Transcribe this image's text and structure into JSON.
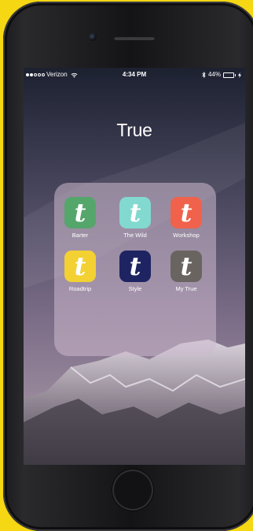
{
  "status_bar": {
    "carrier": "Verizon",
    "time": "4:34 PM",
    "battery_percent": "44%",
    "battery_level": 0.44,
    "signal_dots_filled": 2,
    "signal_dots_total": 5
  },
  "folder": {
    "title": "True",
    "apps": [
      {
        "label": "Barter",
        "letter": "t",
        "color": "#55a66b"
      },
      {
        "label": "The Wild",
        "letter": "t",
        "color": "#82d9cf"
      },
      {
        "label": "Workshop",
        "letter": "t",
        "color": "#f0624b"
      },
      {
        "label": "Roadtrip",
        "letter": "t",
        "color": "#f3d133"
      },
      {
        "label": "Style",
        "letter": "t",
        "color": "#1e2462"
      },
      {
        "label": "My True",
        "letter": "t",
        "color": "#6a6461"
      }
    ]
  },
  "icons": [
    "wifi-icon",
    "bluetooth-icon",
    "battery-icon",
    "charging-icon"
  ]
}
